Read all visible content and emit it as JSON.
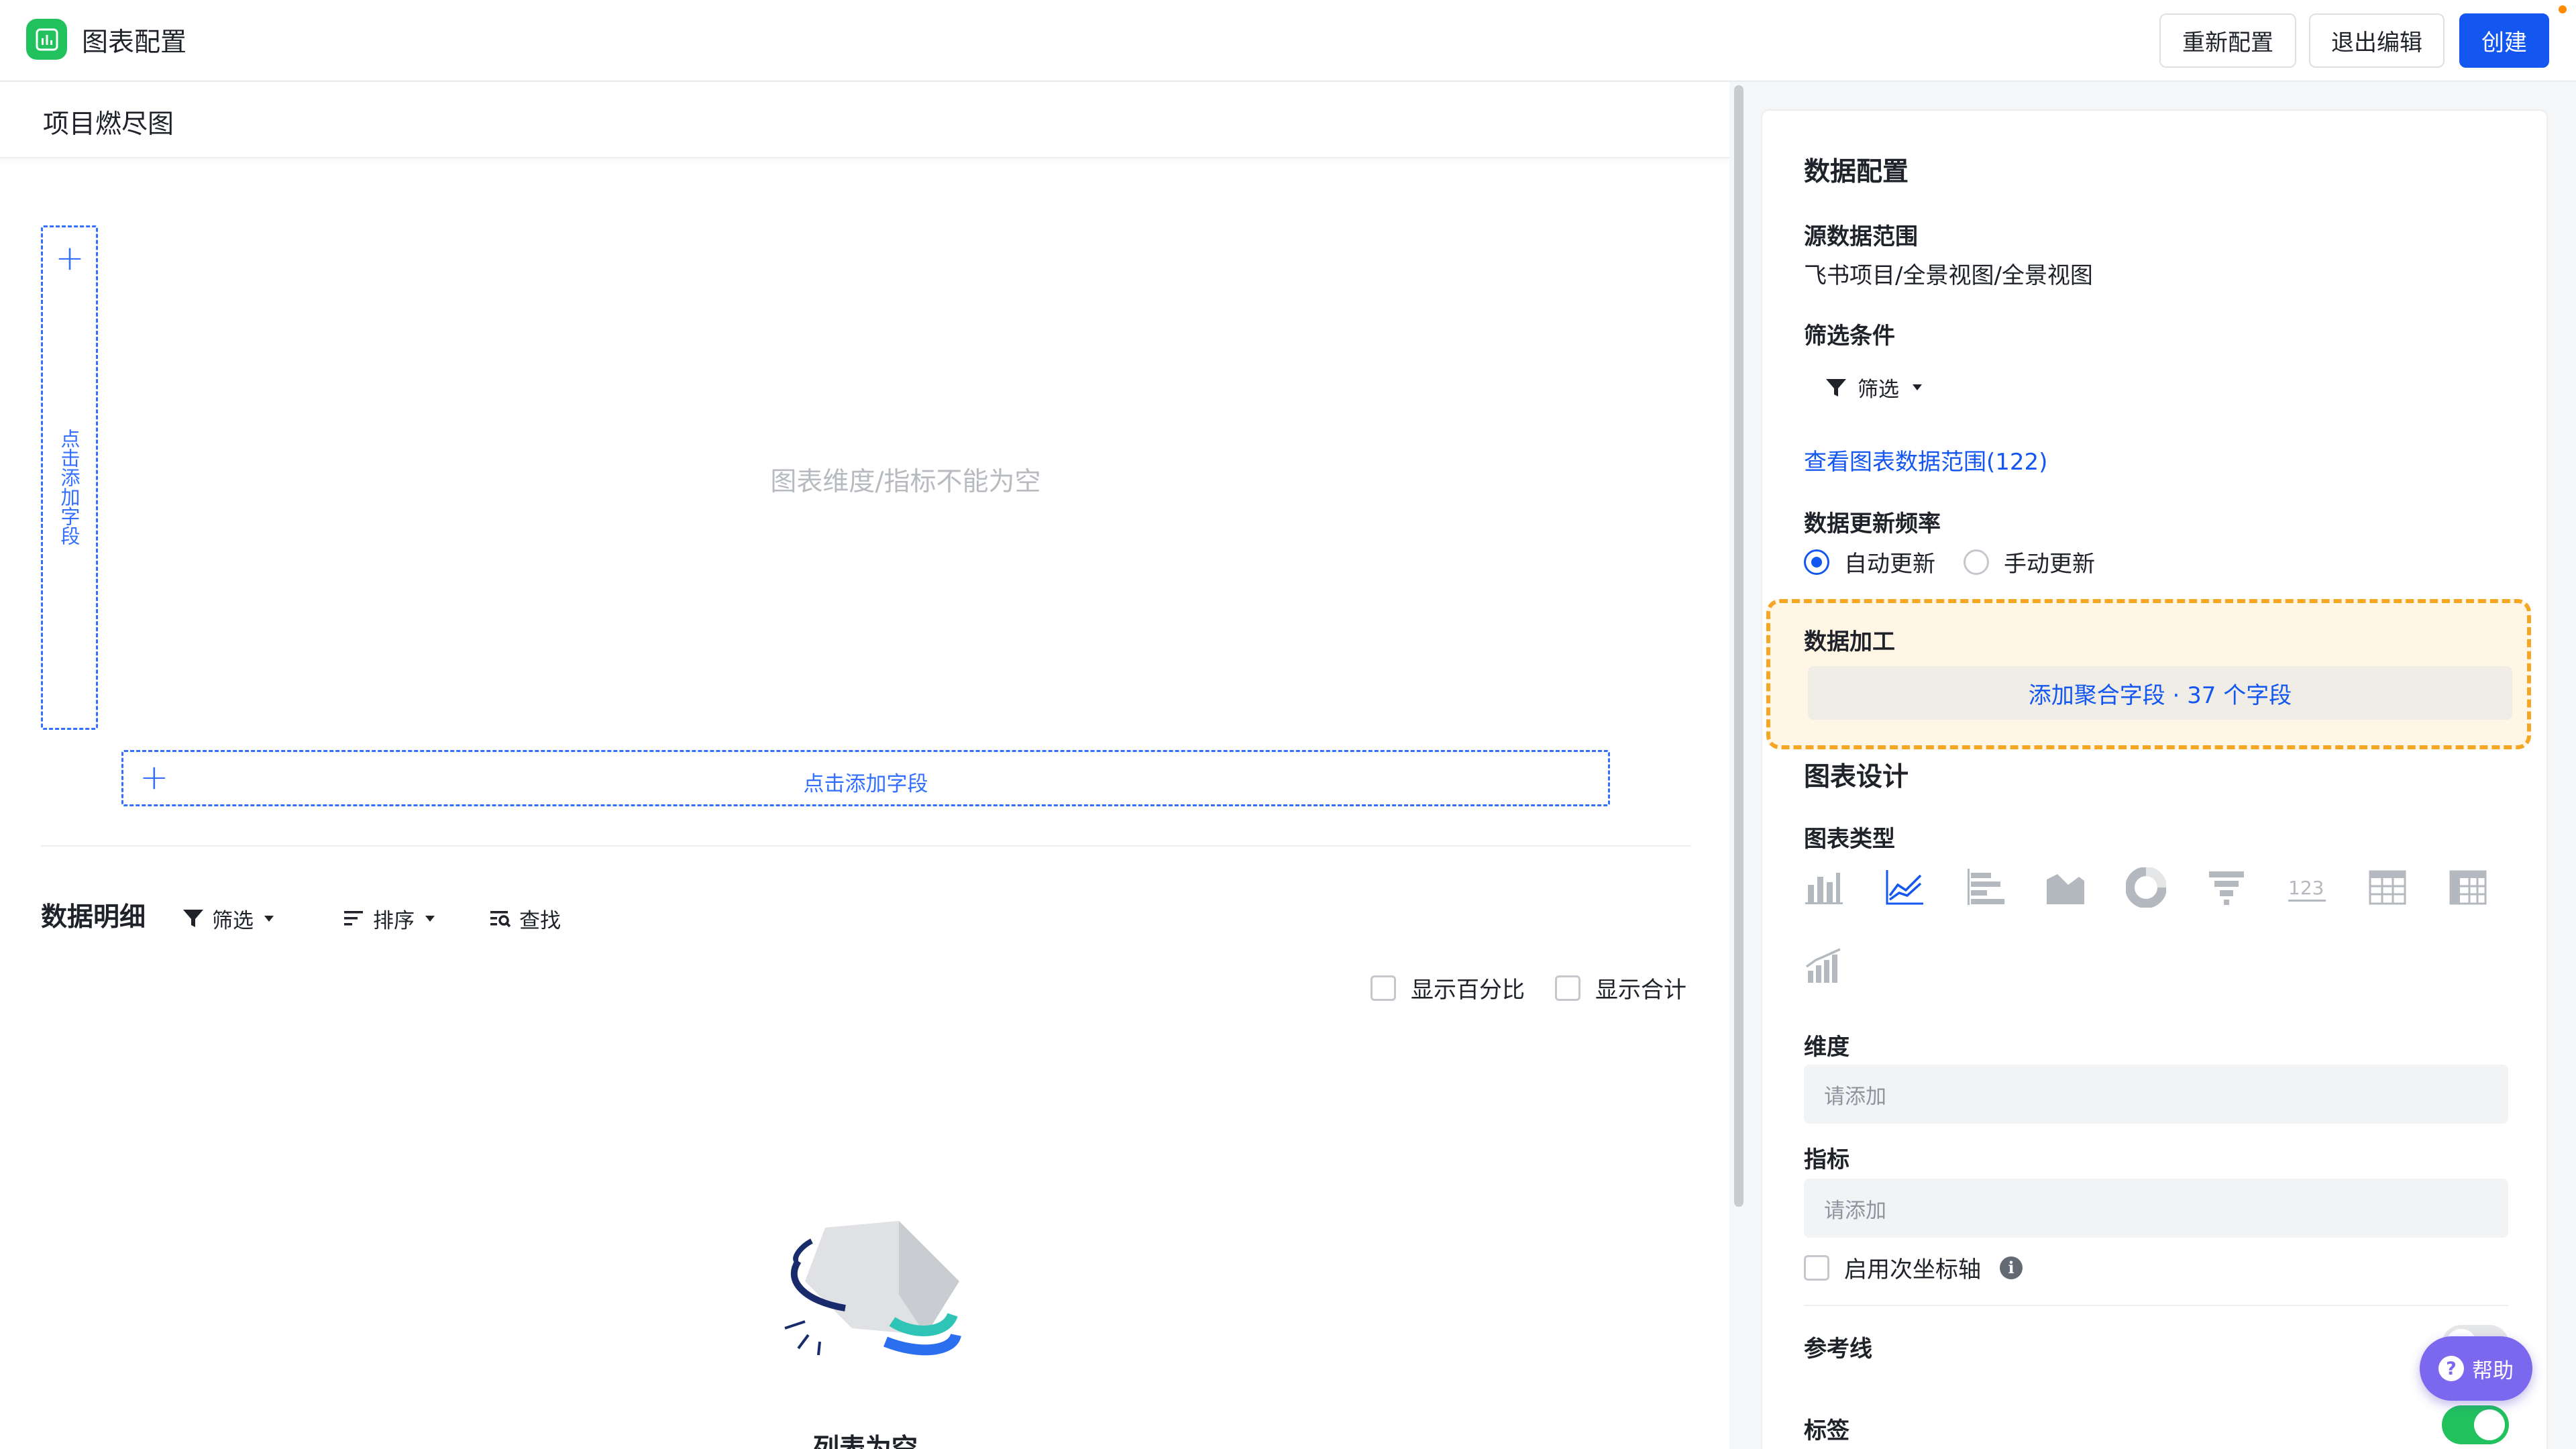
{
  "header": {
    "title": "图表配置",
    "buttons": {
      "reconfigure": "重新配置",
      "exit_edit": "退出编辑",
      "create": "创建"
    }
  },
  "chart": {
    "title": "项目燃尽图",
    "vertical_drop_label": "点击添加字段",
    "horizontal_drop_label": "点击添加字段",
    "empty_tip": "图表维度/指标不能为空"
  },
  "detail": {
    "title": "数据明细",
    "filter": "筛选",
    "sort": "排序",
    "find": "查找",
    "show_percent": "显示百分比",
    "show_total": "显示合计",
    "empty_text": "列表为空"
  },
  "panel": {
    "data_config_title": "数据配置",
    "source_range_label": "源数据范围",
    "source_range_value": "飞书项目/全景视图/全景视图",
    "filter_label": "筛选条件",
    "filter_button": "筛选",
    "view_range_link": "查看图表数据范围(122)",
    "update_freq_label": "数据更新频率",
    "update_auto": "自动更新",
    "update_manual": "手动更新",
    "processing_label": "数据加工",
    "add_agg_button": "添加聚合字段 · 37 个字段",
    "chart_design_title": "图表设计",
    "chart_type_label": "图表类型",
    "chart_types": [
      "bar-chart",
      "line-chart",
      "horizontal-bar-chart",
      "area-chart",
      "pie-chart",
      "funnel-chart",
      "number-card",
      "table",
      "pivot-table",
      "combo-chart"
    ],
    "selected_chart_type": "line-chart",
    "dimension_label": "维度",
    "dimension_placeholder": "请添加",
    "metric_label": "指标",
    "metric_placeholder": "请添加",
    "secondary_axis_label": "启用次坐标轴",
    "reference_line_label": "参考线",
    "tag_label": "标签"
  },
  "help": {
    "label": "帮助"
  },
  "colors": {
    "primary": "#1456f0",
    "accent_green": "#21c25e",
    "highlight_border": "#f5a623",
    "help_purple": "#7b68ee"
  }
}
